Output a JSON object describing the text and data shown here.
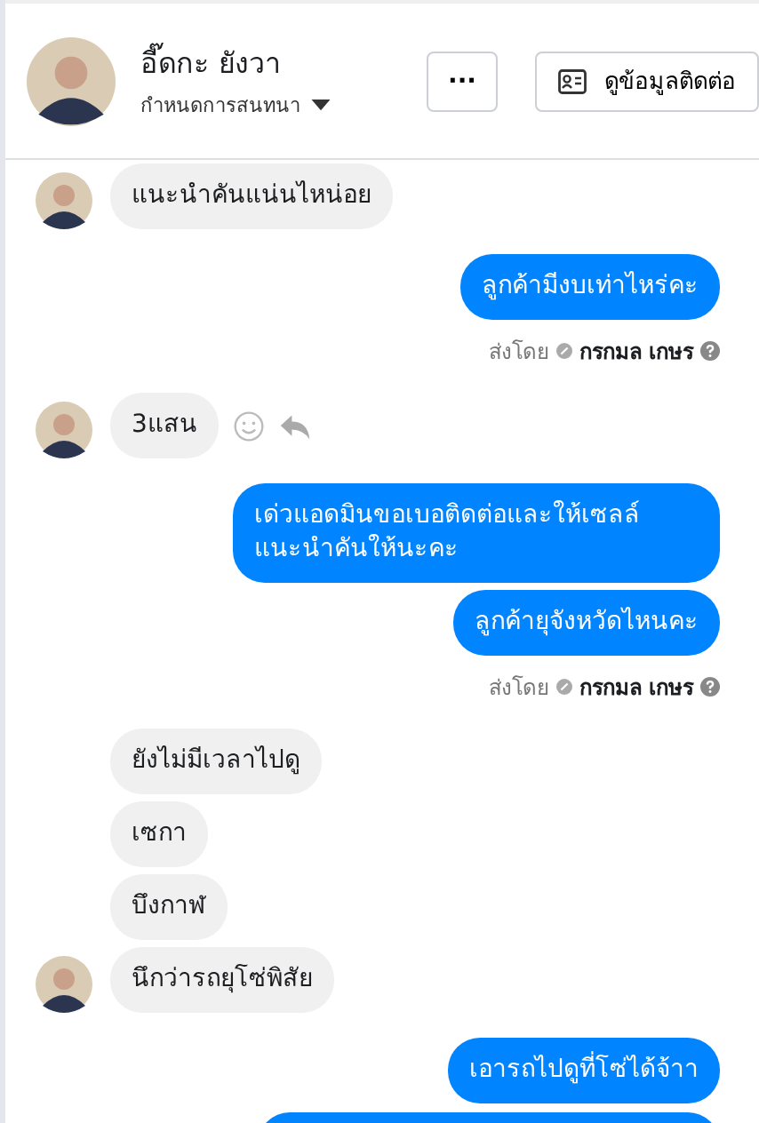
{
  "header": {
    "name": "อี๊ดกะ ยังวา",
    "subtitle": "กำหนดการสนทนา",
    "more_button": "···",
    "contact_button": "ดูข้อมูลติดต่อ"
  },
  "messages": [
    {
      "kind": "in",
      "text": "แนะนำคันแน่นไหน่อย",
      "avatar": true,
      "actions": false
    },
    {
      "kind": "out",
      "text": "ลูกค้ามีงบเท่าไหร่คะ"
    },
    {
      "kind": "sent_by",
      "label": "ส่งโดย",
      "sender": "กรกมล เกษร"
    },
    {
      "kind": "in",
      "text": "3แสน",
      "avatar": true,
      "actions": true
    },
    {
      "kind": "out",
      "text": "เด่วแอดมินขอเบอติดต่อและให้เซลล์แนะนำคันให้นะคะ"
    },
    {
      "kind": "out",
      "text": "ลูกค้ายุจังหวัดไหนคะ"
    },
    {
      "kind": "sent_by",
      "label": "ส่งโดย",
      "sender": "กรกมล เกษร"
    },
    {
      "kind": "in",
      "text": "ยังไม่มีเวลาไปดู",
      "avatar": false,
      "actions": false
    },
    {
      "kind": "in",
      "text": "เซกา",
      "avatar": false,
      "actions": false
    },
    {
      "kind": "in",
      "text": "บึงกาฬ",
      "avatar": false,
      "actions": false
    },
    {
      "kind": "in",
      "text": "นึกว่ารถยุโซ่พิสัย",
      "avatar": true,
      "actions": false
    },
    {
      "kind": "out",
      "text": "เอารถไปดูที่โซ่ได้จ้าา"
    }
  ]
}
